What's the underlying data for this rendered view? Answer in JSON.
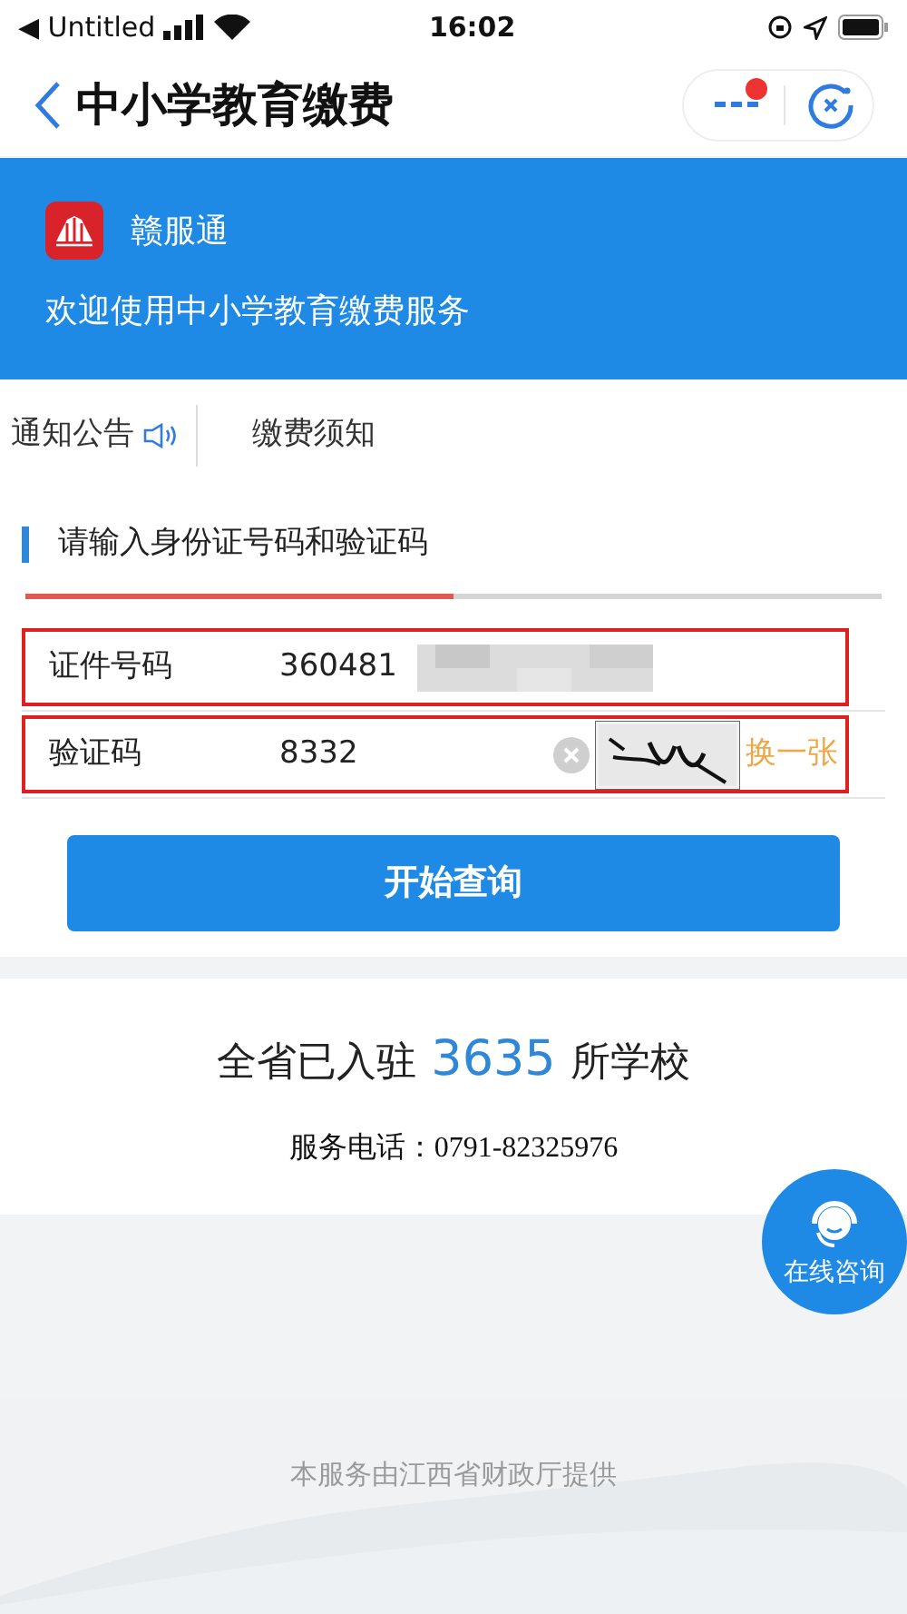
{
  "status_bar": {
    "back_label": "◀ Untitled",
    "time": "16:02"
  },
  "nav": {
    "title": "中小学教育缴费",
    "notification_dot": true
  },
  "banner": {
    "app_name": "赣服通",
    "welcome": "欢迎使用中小学教育缴费服务"
  },
  "tabs": [
    {
      "label": "通知公告",
      "kind": "sound"
    },
    {
      "label": "缴费须知",
      "kind": "plain"
    }
  ],
  "form": {
    "heading": "请输入身份证号码和验证码",
    "progress": {
      "level": 0.5
    },
    "fields": [
      {
        "label": "证件号码",
        "value": "360481",
        "kind": "masked",
        "highlighted": true
      },
      {
        "label": "验证码",
        "value": "8332",
        "kind": "captcha",
        "highlighted": true,
        "refresh": "换一张"
      }
    ],
    "submit": "开始查询"
  },
  "stats": {
    "prefix": "全省已入驻",
    "count": "3635",
    "suffix": "所学校",
    "phone": "服务电话：0791-82325976"
  },
  "consult": "在线咨询",
  "footer": "本服务由江西省财政厅提供"
}
